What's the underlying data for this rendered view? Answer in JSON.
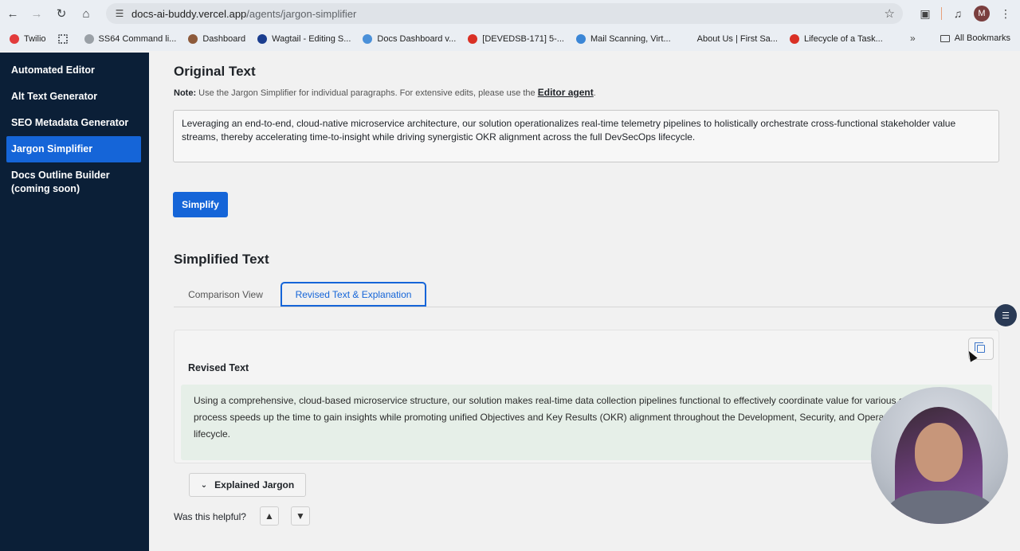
{
  "browser": {
    "url_host": "docs-ai-buddy.vercel.app",
    "url_path": "/agents/jargon-simplifier",
    "avatar_letter": "M",
    "bookmarks": [
      {
        "label": "Twilio",
        "color": "#e23b3b"
      },
      {
        "label": "",
        "color": "#5f6368"
      },
      {
        "label": "SS64 Command li...",
        "color": "#9aa0a6"
      },
      {
        "label": "Dashboard",
        "color": "#8d5a3b"
      },
      {
        "label": "Wagtail - Editing S...",
        "color": "#1a3d8f"
      },
      {
        "label": "Docs Dashboard v...",
        "color": "#4a90d9"
      },
      {
        "label": "[DEVEDSB-171] 5-...",
        "color": "#d93025"
      },
      {
        "label": "Mail Scanning, Virt...",
        "color": "#3b86d6"
      },
      {
        "label": "About Us | First Sa...",
        "color": "#eaeef3"
      },
      {
        "label": "Lifecycle of a Task...",
        "color": "#d93025"
      }
    ],
    "more_bookmarks": "»",
    "all_bookmarks": "All Bookmarks"
  },
  "sidebar": {
    "items": [
      {
        "label": "Automated Editor"
      },
      {
        "label": "Alt Text Generator"
      },
      {
        "label": "SEO Metadata Generator"
      },
      {
        "label": "Jargon Simplifier"
      },
      {
        "label": "Docs Outline Builder (coming soon)"
      }
    ]
  },
  "main": {
    "original_title": "Original Text",
    "note_label": "Note:",
    "note_text": " Use the Jargon Simplifier for individual paragraphs. For extensive edits, please use the ",
    "note_link": "Editor agent",
    "note_end": ".",
    "original_text": "Leveraging an end-to-end, cloud-native microservice architecture, our solution operationalizes real-time telemetry pipelines to holistically orchestrate cross-functional stakeholder value streams, thereby accelerating time-to-insight while driving synergistic OKR alignment across the full DevSecOps lifecycle.",
    "simplify_label": "Simplify",
    "simplified_title": "Simplified Text",
    "tabs": [
      {
        "label": "Comparison View"
      },
      {
        "label": "Revised Text & Explanation"
      }
    ],
    "revised_title": "Revised Text",
    "revised_text": "Using a comprehensive, cloud-based microservice structure, our solution makes real-time data collection pipelines functional to effectively coordinate value for various stakeholders. This process speeds up the time to gain insights while promoting unified Objectives and Key Results (OKR) alignment throughout the Development, Security, and Operations (DevSecOps) lifecycle.",
    "explained_jargon_label": "Explained Jargon",
    "helpful_label": "Was this helpful?"
  }
}
